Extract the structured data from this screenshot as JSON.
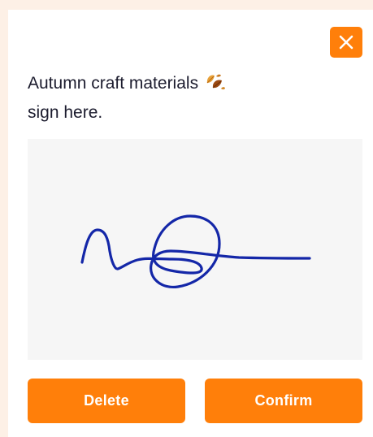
{
  "colors": {
    "page_background": "#fdf0e6",
    "accent": "#ff7f0a",
    "text": "#1c1c2e",
    "signature_ink": "#1427a8",
    "pad_background": "#f6f6f6"
  },
  "dialog": {
    "close_icon": "close-icon",
    "title_line1": "Autumn craft materials",
    "title_icon": "fallen-leaves-icon",
    "title_line2": "sign here.",
    "signature_pad": {
      "state": "signed",
      "signature_icon": "handwritten-signature"
    },
    "buttons": {
      "delete_label": "Delete",
      "confirm_label": "Confirm"
    }
  }
}
